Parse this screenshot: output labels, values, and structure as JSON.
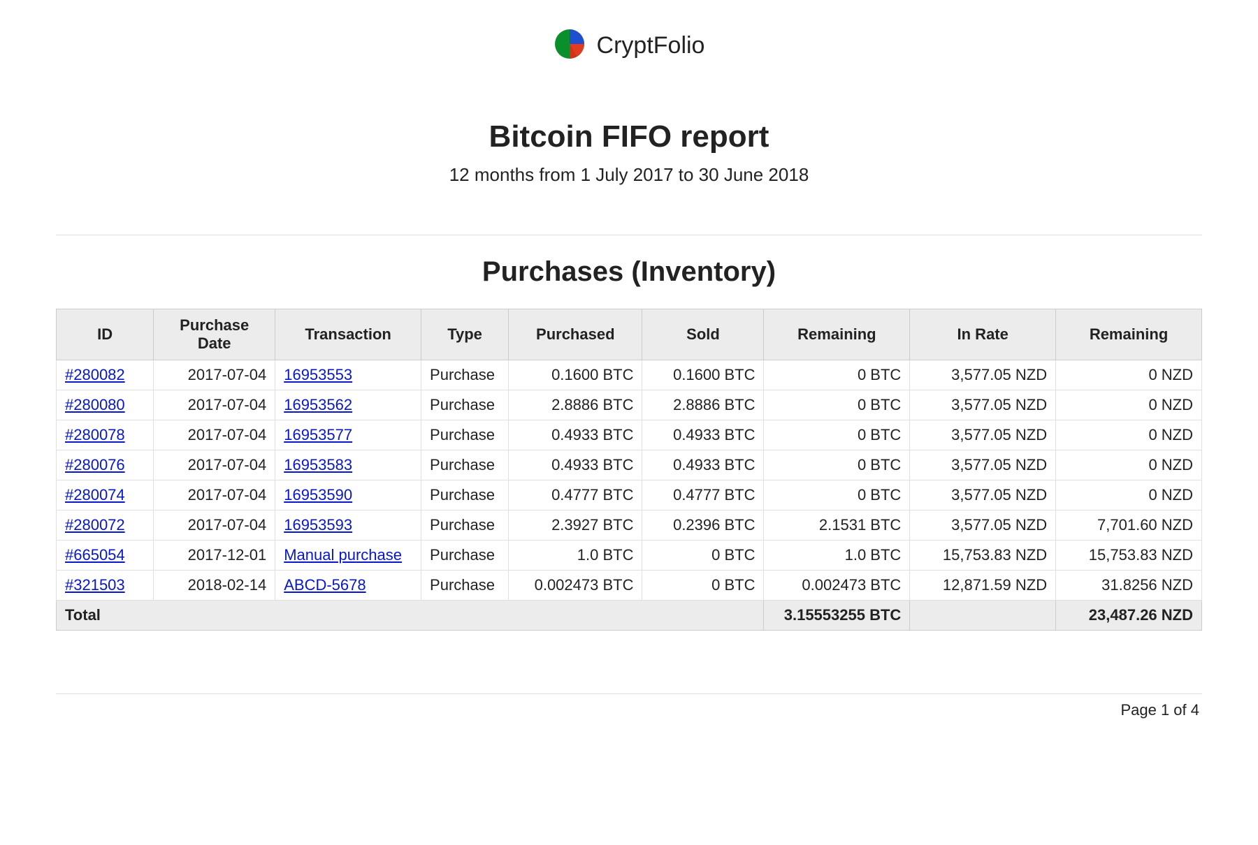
{
  "brand": {
    "name": "CryptFolio"
  },
  "report": {
    "title": "Bitcoin FIFO report",
    "subtitle": "12 months from 1 July 2017 to 30 June 2018"
  },
  "section_title": "Purchases (Inventory)",
  "columns": [
    "ID",
    "Purchase Date",
    "Transaction",
    "Type",
    "Purchased",
    "Sold",
    "Remaining",
    "In Rate",
    "Remaining"
  ],
  "rows": [
    {
      "id": "#280082",
      "date": "2017-07-04",
      "txn": "16953553",
      "type": "Purchase",
      "purchased": "0.1600 BTC",
      "sold": "0.1600 BTC",
      "remaining_btc": "0 BTC",
      "rate": "3,577.05 NZD",
      "remaining_nzd": "0 NZD"
    },
    {
      "id": "#280080",
      "date": "2017-07-04",
      "txn": "16953562",
      "type": "Purchase",
      "purchased": "2.8886 BTC",
      "sold": "2.8886 BTC",
      "remaining_btc": "0 BTC",
      "rate": "3,577.05 NZD",
      "remaining_nzd": "0 NZD"
    },
    {
      "id": "#280078",
      "date": "2017-07-04",
      "txn": "16953577",
      "type": "Purchase",
      "purchased": "0.4933 BTC",
      "sold": "0.4933 BTC",
      "remaining_btc": "0 BTC",
      "rate": "3,577.05 NZD",
      "remaining_nzd": "0 NZD"
    },
    {
      "id": "#280076",
      "date": "2017-07-04",
      "txn": "16953583",
      "type": "Purchase",
      "purchased": "0.4933 BTC",
      "sold": "0.4933 BTC",
      "remaining_btc": "0 BTC",
      "rate": "3,577.05 NZD",
      "remaining_nzd": "0 NZD"
    },
    {
      "id": "#280074",
      "date": "2017-07-04",
      "txn": "16953590",
      "type": "Purchase",
      "purchased": "0.4777 BTC",
      "sold": "0.4777 BTC",
      "remaining_btc": "0 BTC",
      "rate": "3,577.05 NZD",
      "remaining_nzd": "0 NZD"
    },
    {
      "id": "#280072",
      "date": "2017-07-04",
      "txn": "16953593",
      "type": "Purchase",
      "purchased": "2.3927 BTC",
      "sold": "0.2396 BTC",
      "remaining_btc": "2.1531 BTC",
      "rate": "3,577.05 NZD",
      "remaining_nzd": "7,701.60 NZD"
    },
    {
      "id": "#665054",
      "date": "2017-12-01",
      "txn": "Manual purchase",
      "type": "Purchase",
      "purchased": "1.0 BTC",
      "sold": "0 BTC",
      "remaining_btc": "1.0 BTC",
      "rate": "15,753.83 NZD",
      "remaining_nzd": "15,753.83 NZD"
    },
    {
      "id": "#321503",
      "date": "2018-02-14",
      "txn": "ABCD-5678",
      "type": "Purchase",
      "purchased": "0.002473 BTC",
      "sold": "0 BTC",
      "remaining_btc": "0.002473 BTC",
      "rate": "12,871.59 NZD",
      "remaining_nzd": "31.8256 NZD"
    }
  ],
  "totals": {
    "label": "Total",
    "remaining_btc": "3.15553255 BTC",
    "remaining_nzd": "23,487.26 NZD"
  },
  "footer": {
    "page": "Page 1 of 4"
  }
}
